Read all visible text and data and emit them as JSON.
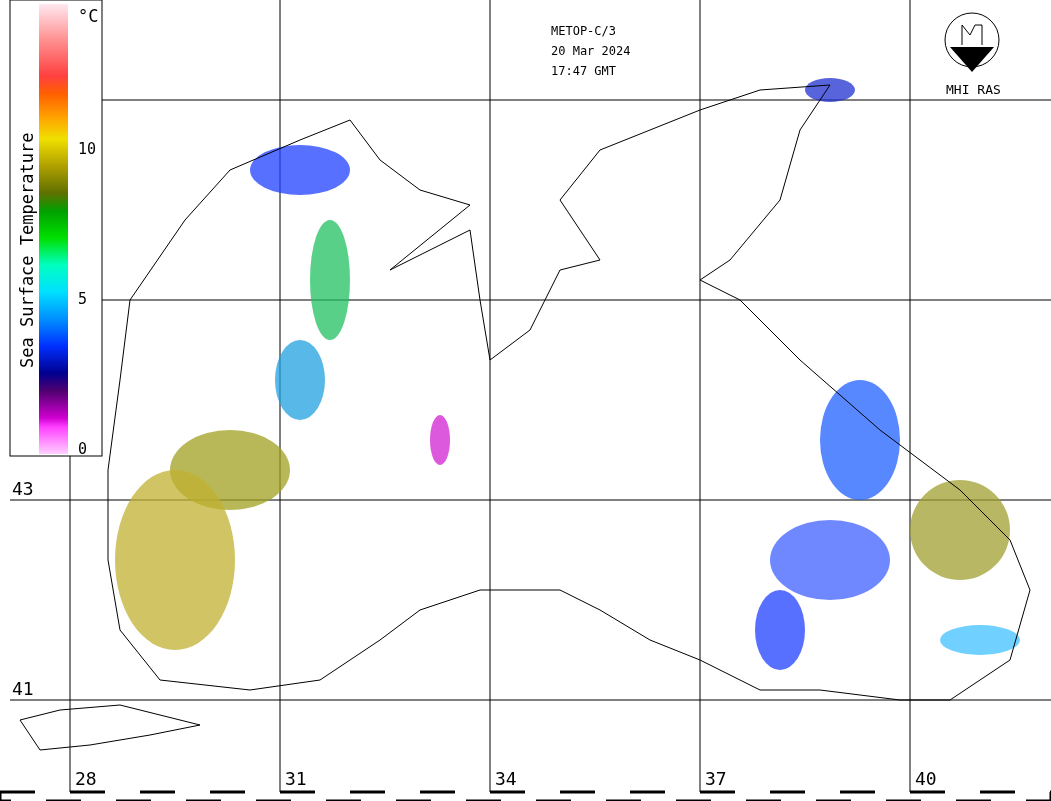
{
  "header": {
    "satellite": "METOP-C/3",
    "date": "20 Mar 2024",
    "time": "17:47 GMT"
  },
  "logo": {
    "label": "MHI RAS"
  },
  "legend": {
    "title": "Sea Surface Temperature",
    "unit": "°C",
    "ticks": [
      "10",
      "5",
      "0"
    ]
  },
  "map": {
    "lat_labels": [
      "43",
      "41"
    ],
    "lon_labels": [
      "28",
      "31",
      "34",
      "37",
      "40"
    ]
  }
}
